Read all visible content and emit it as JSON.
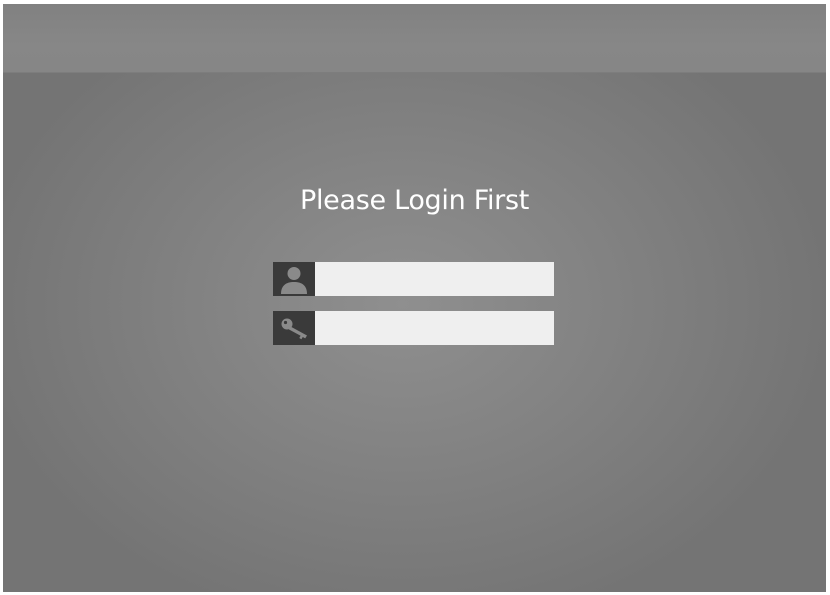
{
  "login": {
    "title": "Please Login First",
    "username": {
      "icon": "user-icon",
      "value": "",
      "placeholder": ""
    },
    "password": {
      "icon": "key-icon",
      "value": "",
      "placeholder": ""
    }
  },
  "colors": {
    "background_center": "#8f8f8f",
    "background_edge": "#747474",
    "header_band": "#858585",
    "title_text": "#ffffff",
    "icon_box": "#3a3a3a",
    "icon_glyph": "#8a8a8a",
    "input_fill": "#efefef"
  }
}
